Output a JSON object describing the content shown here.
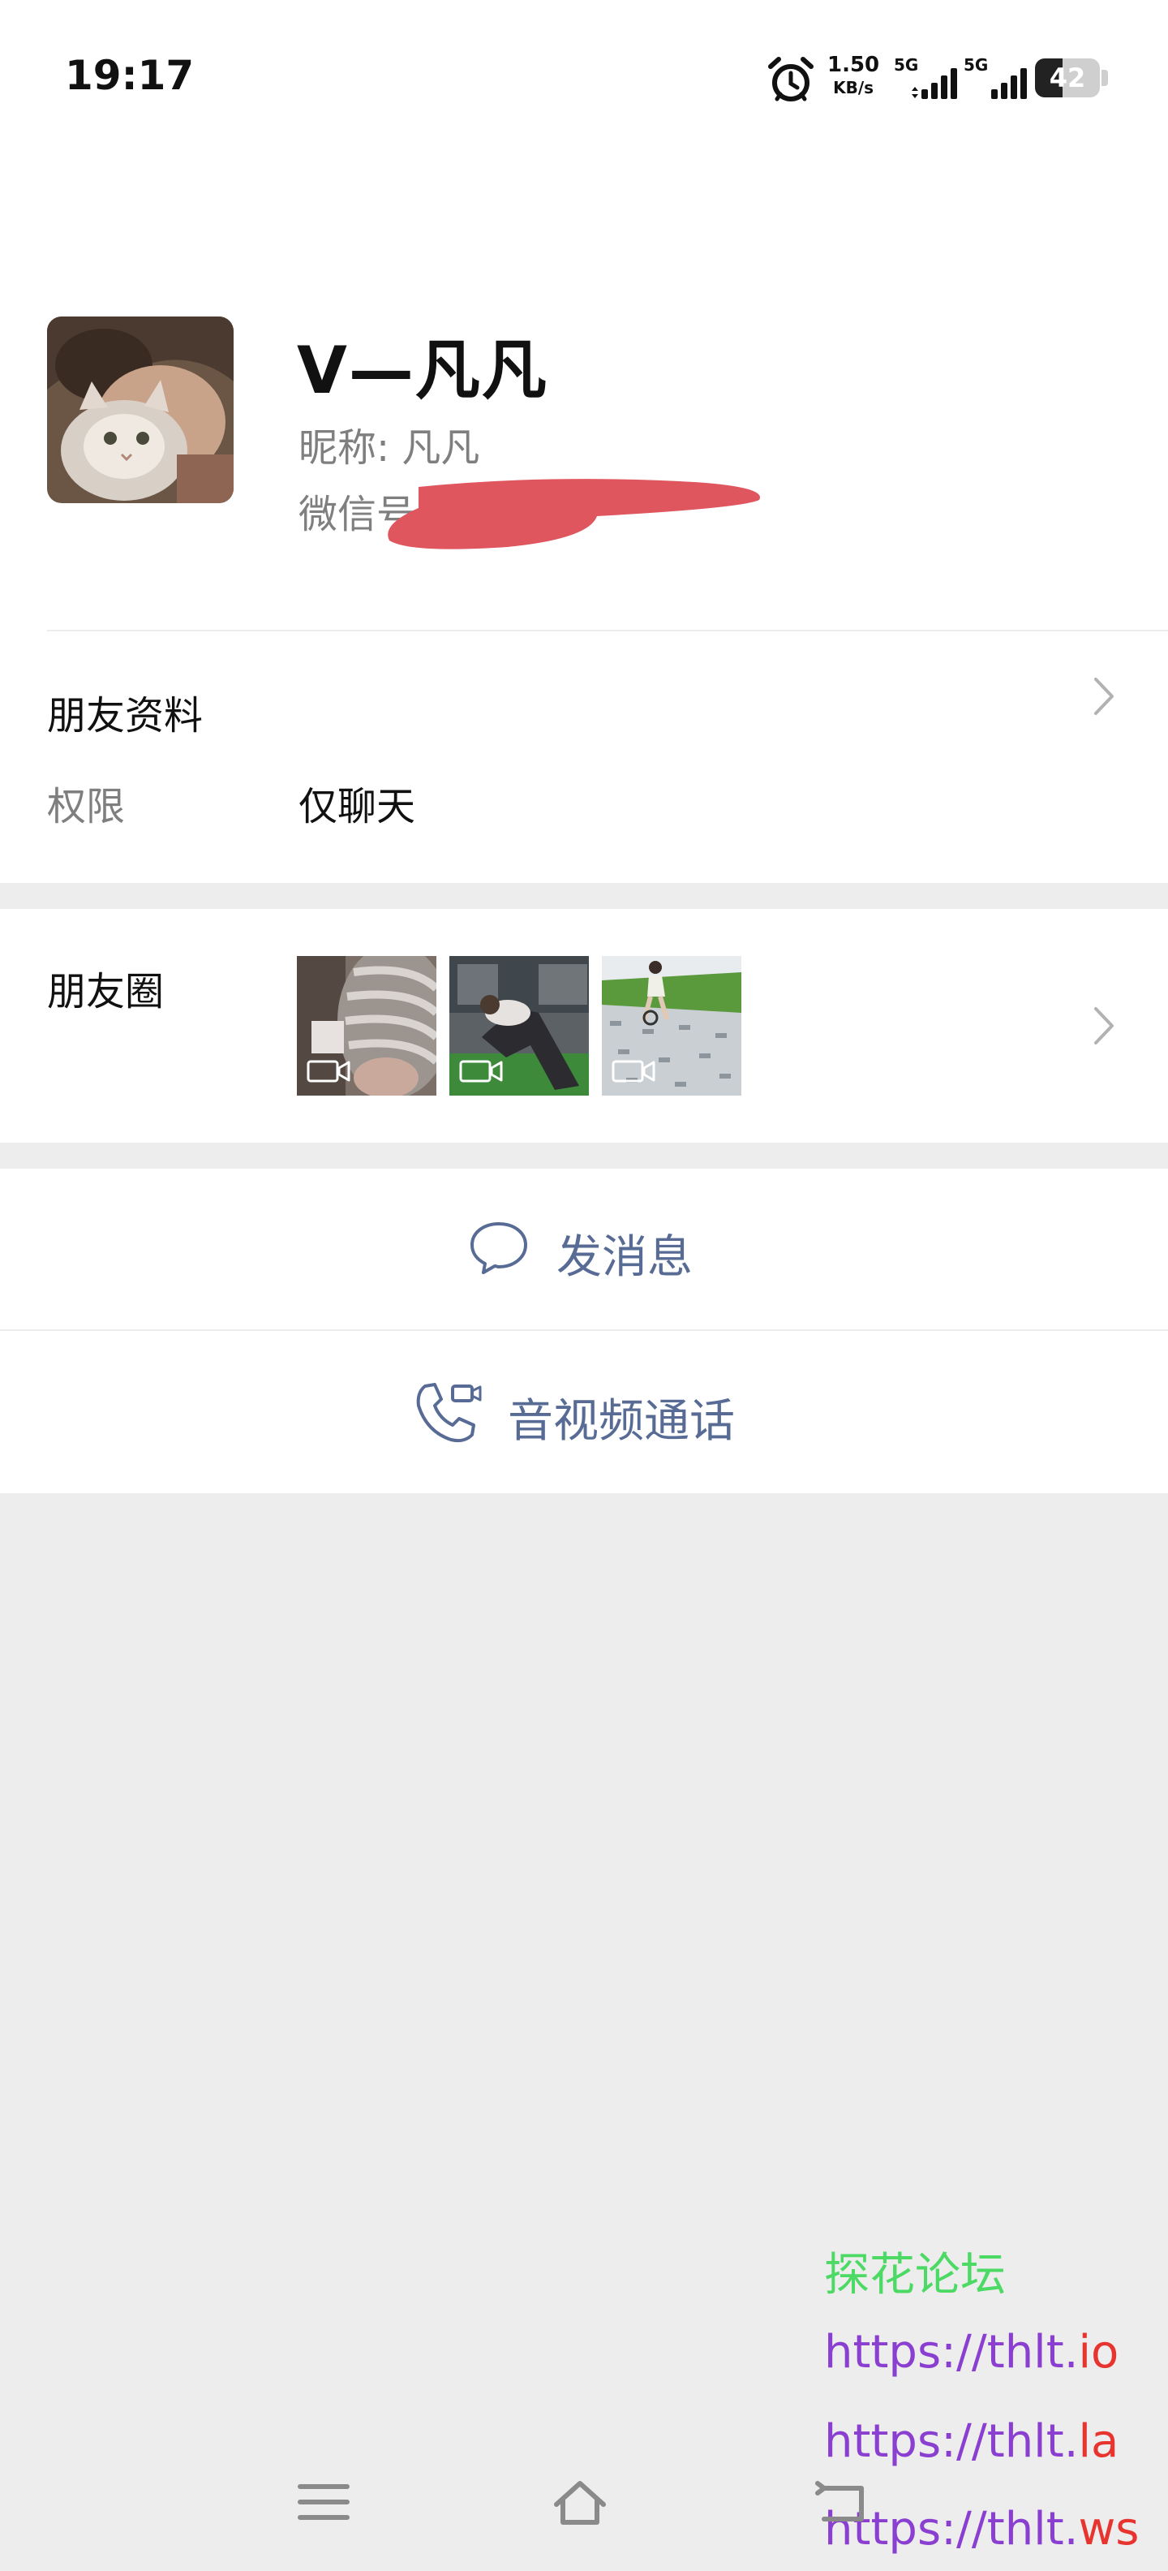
{
  "status_bar": {
    "time": "19:17",
    "net_speed_value": "1.50",
    "net_speed_unit": "KB/s",
    "signal1_label": "5G",
    "signal2_label": "5G",
    "battery_level": "42",
    "icons": [
      "alarm-icon",
      "signal-icon",
      "battery-icon"
    ]
  },
  "nav": {
    "back_icon": "chevron-left-icon",
    "more_icon": "more-dots-icon"
  },
  "profile": {
    "display_name": "V—凡凡",
    "nickname": "昵称: 凡凡",
    "wechat_id_label": "微信号:"
  },
  "friend_info": {
    "title": "朋友资料",
    "permission_label": "权限",
    "permission_value": "仅聊天"
  },
  "moments": {
    "title": "朋友圈",
    "thumbnails": [
      "video-thumbnail-1",
      "video-thumbnail-2",
      "video-thumbnail-3"
    ]
  },
  "actions": {
    "send_message": "发消息",
    "av_call": "音视频通话"
  },
  "watermark": {
    "forum_name": "探花论坛",
    "link1_prefix": "https://thlt.",
    "link1_suffix": "io",
    "link2_prefix": "https://thlt.",
    "link2_suffix": "la",
    "link3_prefix": "https://thlt.",
    "link3_suffix": "ws"
  },
  "colors": {
    "link_blue": "#576b95",
    "background": "#ededed",
    "watermark_green": "#4cd964",
    "watermark_purple": "#8a3fd1",
    "watermark_red": "#e8342f",
    "redaction_red": "#e0565e"
  }
}
